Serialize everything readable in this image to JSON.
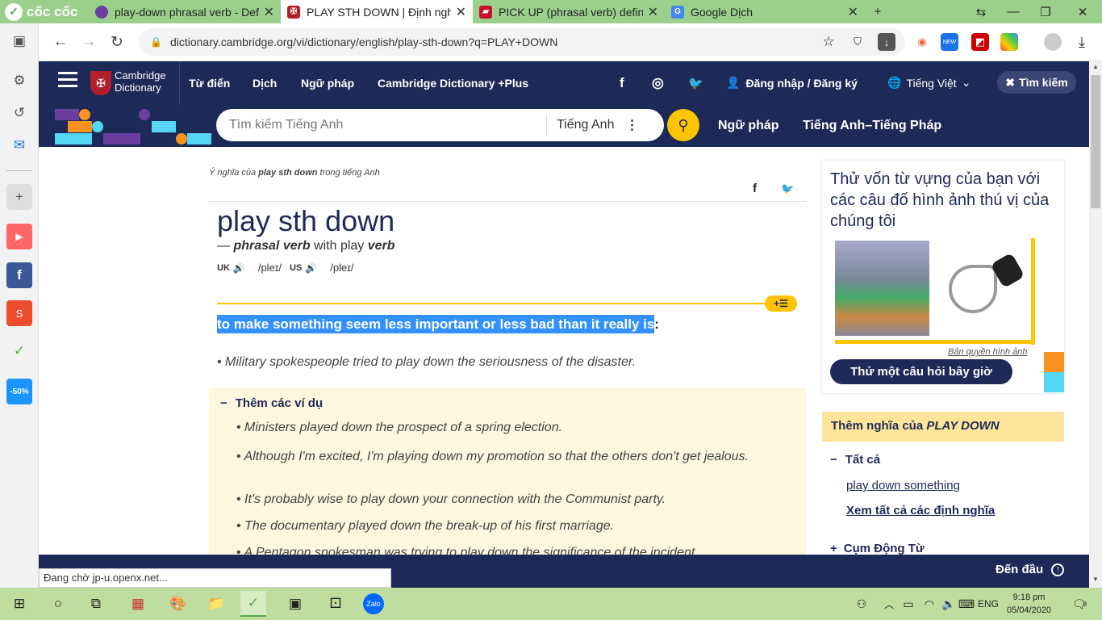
{
  "browser": {
    "brand": "cốc cốc",
    "tabs": [
      {
        "title": "play-down phrasal verb - Defi",
        "icon": "tab-icon",
        "color": "#6b3fa0"
      },
      {
        "title": "PLAY STH DOWN | Định nghĩa",
        "icon": "cambridge-icon",
        "color": "#b4202a"
      },
      {
        "title": "PICK UP (phrasal verb) definit",
        "icon": "book-icon",
        "color": "#c8102e"
      },
      {
        "title": "Google Dịch",
        "icon": "google-translate-icon",
        "color": "#4285f4"
      }
    ],
    "url": "dictionary.cambridge.org/vi/dictionary/english/play-sth-down?q=PLAY+DOWN"
  },
  "header": {
    "logo_line1": "Cambridge",
    "logo_line2": "Dictionary",
    "nav": [
      "Từ điển",
      "Dịch",
      "Ngữ pháp",
      "Cambridge Dictionary +Plus"
    ],
    "login": "Đăng nhập / Đăng ký",
    "lang": "Tiếng Việt",
    "search_close": "Tìm kiếm"
  },
  "search": {
    "placeholder": "Tìm kiếm Tiếng Anh",
    "dict": "Tiếng Anh",
    "links": [
      "Ngữ pháp",
      "Tiếng Anh–Tiếng Pháp"
    ]
  },
  "entry": {
    "breadcrumb_pre": "Ý nghĩa của ",
    "breadcrumb_word": "play sth down",
    "breadcrumb_post": " trong tiếng Anh",
    "headword": "play sth down",
    "pos_dash": "— ",
    "pos": "phrasal verb",
    "with": " with play ",
    "with_pos": "verb",
    "uk": "UK",
    "uk_ipa": "/pleɪ/",
    "us": "US",
    "us_ipa": "/pleɪ/",
    "definition": "to make something seem less important or less bad than it really is",
    "colon": ":",
    "example": "Military spokespeople tried to play down the seriousness of the disaster.",
    "more_title": "Thêm các ví dụ",
    "more_examples": [
      "Ministers played down the prospect of a spring election.",
      "Although I'm excited, I'm playing down my promotion so that the others don't get jealous.",
      "It's probably wise to play down your connection with the Communist party.",
      "The documentary played down the break-up of his first marriage.",
      "A Pentagon spokesman was trying to play down the significance of the incident."
    ]
  },
  "sidebar": {
    "quiz_text": "Thử vốn từ vựng của bạn với các câu đố hình ảnh thú vị của chúng tôi",
    "copyright": "Bản quyền hình ảnh",
    "quiz_button": "Thử một câu hỏi bây giờ",
    "more_label": "Thêm nghĩa của ",
    "more_word": "PLAY DOWN",
    "all": "Tất cả",
    "link1": "play down something",
    "see_all": "Xem tất cả các định nghĩa",
    "phrasal": "Cụm Động Từ"
  },
  "bottom": {
    "back_top": "Đến đầu"
  },
  "status": "Đang chờ jp-u.openx.net...",
  "taskbar": {
    "lang": "ENG",
    "time": "9:18 pm",
    "date": "05/04/2020",
    "notif": "8"
  }
}
